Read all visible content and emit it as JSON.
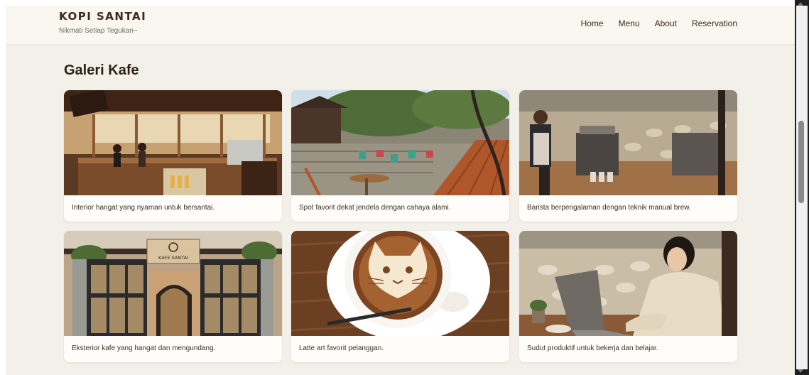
{
  "header": {
    "brand": "KOPI SANTAI",
    "tagline": "Nikmati Setiap Tegukan~",
    "nav": [
      "Home",
      "Menu",
      "About",
      "Reservation"
    ]
  },
  "gallery": {
    "title": "Galeri Kafe",
    "items": [
      {
        "caption": "Interior hangat yang nyaman untuk bersantai.",
        "image": "cafe-interior-image"
      },
      {
        "caption": "Spot favorit dekat jendela dengan cahaya alami.",
        "image": "garden-terrace-image"
      },
      {
        "caption": "Barista berpengalaman dengan teknik manual brew.",
        "image": "barista-image"
      },
      {
        "caption": "Eksterior kafe yang hangat dan mengundang.",
        "image": "cafe-exterior-image"
      },
      {
        "caption": "Latte art favorit pelanggan.",
        "image": "latte-art-image"
      },
      {
        "caption": "Sudut produktif untuk bekerja dan belajar.",
        "image": "working-corner-image"
      }
    ],
    "sign_text": "KAFE SANTAI"
  },
  "colors": {
    "page_bg": "#f3f0ea",
    "header_bg": "#faf7f0",
    "card_bg": "#fffdf9",
    "text_dark": "#2c1f16"
  }
}
